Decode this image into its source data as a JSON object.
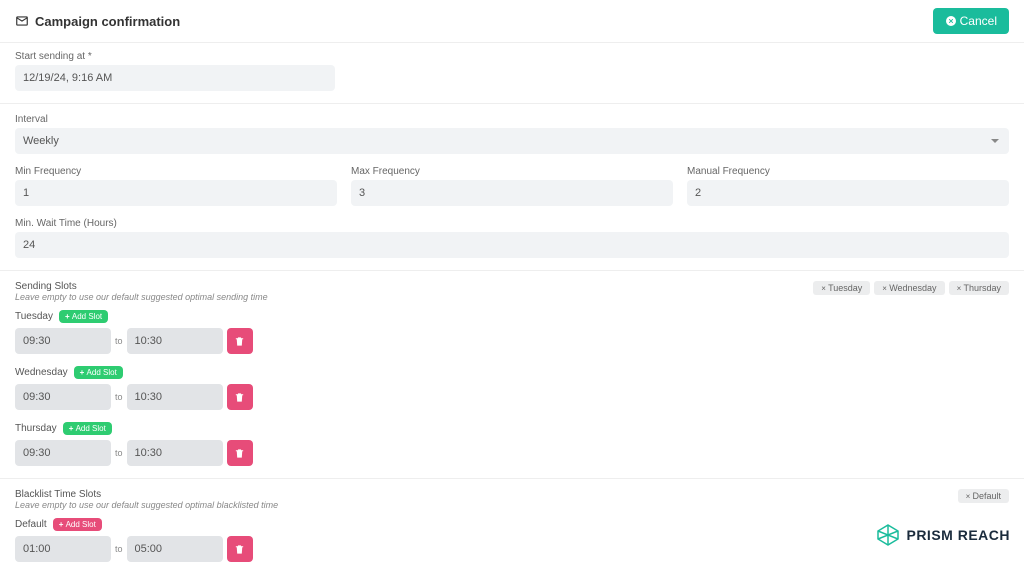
{
  "header": {
    "title": "Campaign confirmation",
    "cancel_label": "Cancel"
  },
  "fields": {
    "start_label": "Start sending at *",
    "start_value": "12/19/24, 9:16 AM",
    "interval_label": "Interval",
    "interval_value": "Weekly",
    "min_freq_label": "Min Frequency",
    "min_freq_value": "1",
    "max_freq_label": "Max Frequency",
    "max_freq_value": "3",
    "manual_freq_label": "Manual Frequency",
    "manual_freq_value": "2",
    "min_wait_label": "Min. Wait Time (Hours)",
    "min_wait_value": "24"
  },
  "sending_slots": {
    "title": "Sending Slots",
    "help": "Leave empty to use our default suggested optimal sending time",
    "tags": {
      "tue": "Tuesday",
      "wed": "Wednesday",
      "thu": "Thursday"
    },
    "add_label": "Add Slot",
    "to_label": "to",
    "slots": [
      {
        "day": "Tuesday",
        "from": "09:30",
        "to": "10:30"
      },
      {
        "day": "Wednesday",
        "from": "09:30",
        "to": "10:30"
      },
      {
        "day": "Thursday",
        "from": "09:30",
        "to": "10:30"
      }
    ]
  },
  "blacklist_slots": {
    "title": "Blacklist Time Slots",
    "help": "Leave empty to use our default suggested optimal blacklisted time",
    "tags": {
      "default": "Default"
    },
    "add_label": "Add Slot",
    "to_label": "to",
    "slot": {
      "day": "Default",
      "from": "01:00",
      "to": "05:00"
    }
  },
  "brand": "PRISM REACH"
}
